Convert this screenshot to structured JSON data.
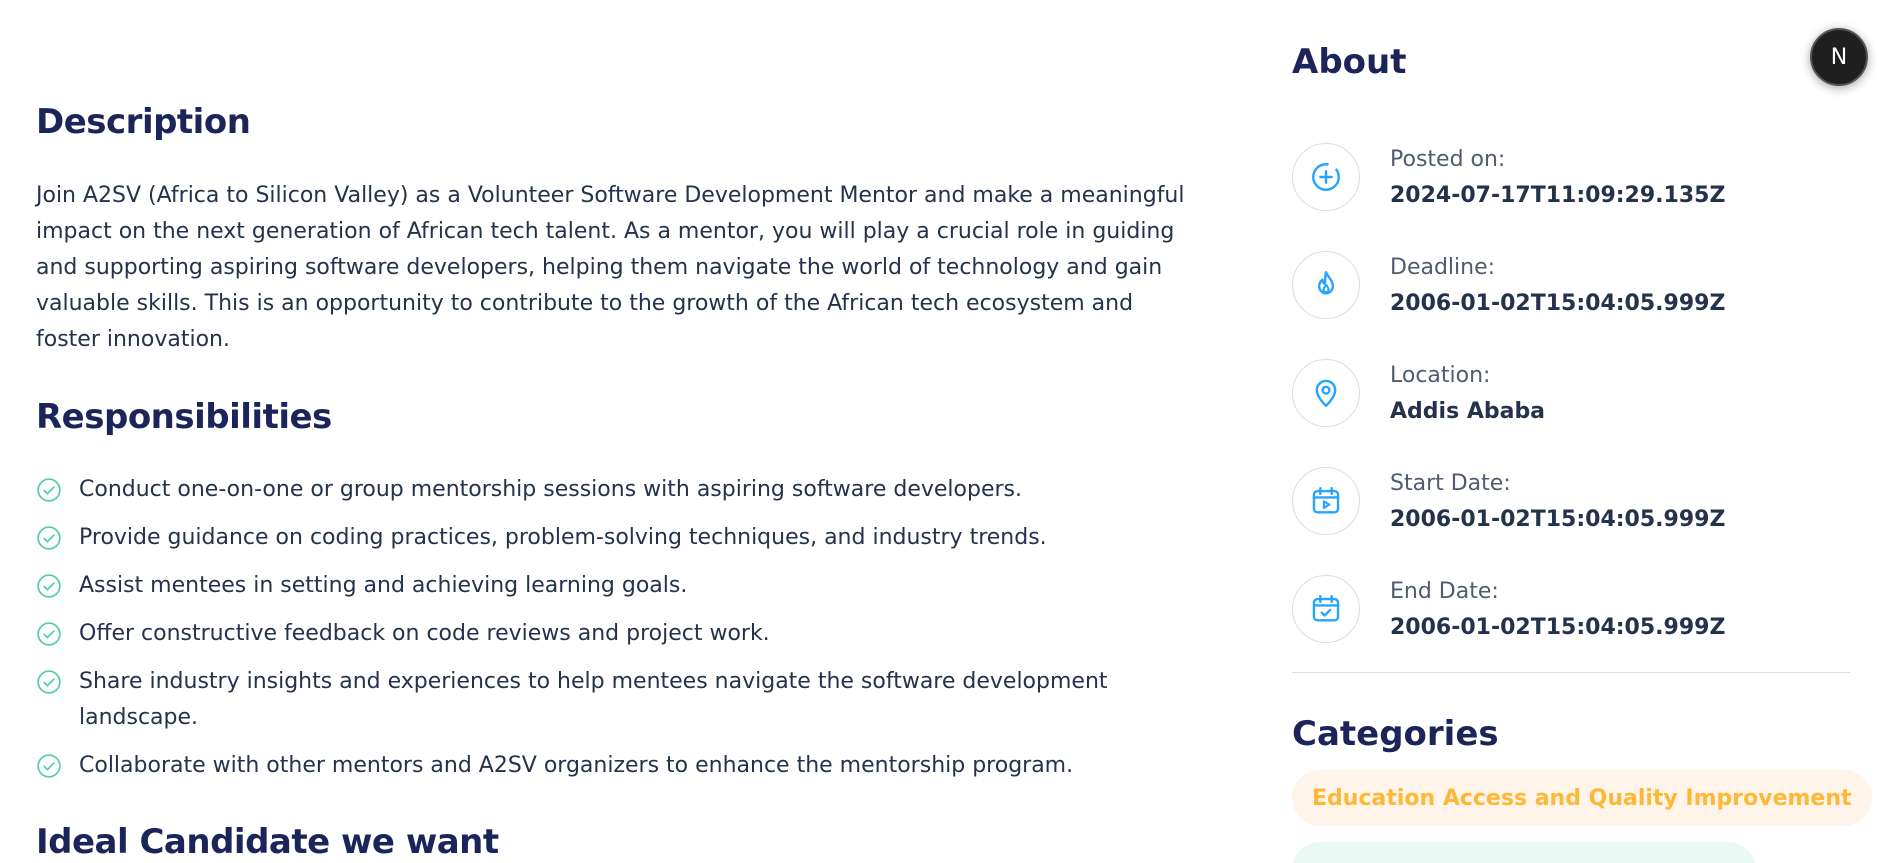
{
  "description": {
    "title": "Description",
    "text": "Join A2SV (Africa to Silicon Valley) as a Volunteer Software Development Mentor and make a meaningful impact on the next generation of African tech talent. As a mentor, you will play a crucial role in guiding and supporting aspiring software developers, helping them navigate the world of technology and gain valuable skills. This is an opportunity to contribute to the growth of the African tech ecosystem and foster innovation."
  },
  "responsibilities": {
    "title": "Responsibilities",
    "items": [
      "Conduct one-on-one or group mentorship sessions with aspiring software developers.",
      "Provide guidance on coding practices, problem-solving techniques, and industry trends.",
      "Assist mentees in setting and achieving learning goals.",
      "Offer constructive feedback on code reviews and project work.",
      "Share industry insights and experiences to help mentees navigate the software development landscape.",
      "Collaborate with other mentors and A2SV organizers to enhance the mentorship program."
    ]
  },
  "ideal_candidate": {
    "title": "Ideal Candidate we want"
  },
  "about": {
    "title": "About",
    "items": [
      {
        "icon": "plus-circle-icon",
        "label": "Posted on:",
        "value": "2024-07-17T11:09:29.135Z"
      },
      {
        "icon": "fire-icon",
        "label": "Deadline:",
        "value": "2006-01-02T15:04:05.999Z"
      },
      {
        "icon": "location-pin-icon",
        "label": "Location:",
        "value": "Addis Ababa"
      },
      {
        "icon": "calendar-play-icon",
        "label": "Start Date:",
        "value": "2006-01-02T15:04:05.999Z"
      },
      {
        "icon": "calendar-check-icon",
        "label": "End Date:",
        "value": "2006-01-02T15:04:05.999Z"
      }
    ]
  },
  "categories": {
    "title": "Categories",
    "items": [
      "Education Access and Quality Improvement",
      ""
    ]
  },
  "avatar": {
    "letter": "N"
  },
  "colors": {
    "heading": "#1B2559",
    "text": "#25324B",
    "icon_blue": "#26A4FF",
    "check_green": "#56CDAD",
    "pill_orange_bg": "#FEF4EA",
    "pill_orange_text": "#FFB836",
    "pill_green_bg": "#EAF9F3"
  }
}
